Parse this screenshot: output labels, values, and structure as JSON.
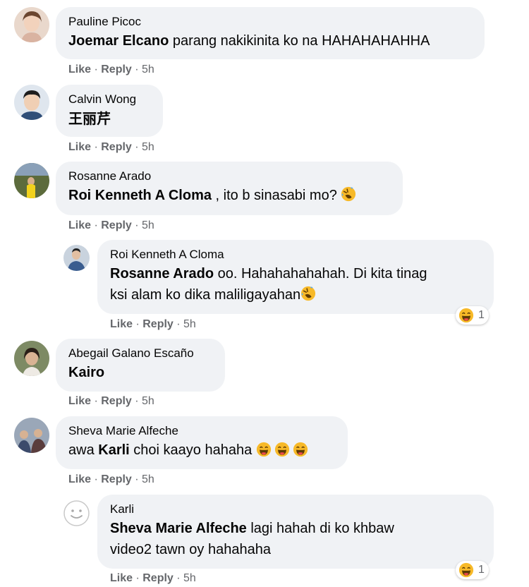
{
  "comments": [
    {
      "author": "Pauline Picoc",
      "mention": "Joemar Elcano",
      "text": " parang nakikinita ko na HAHAHAHAHHA",
      "like": "Like",
      "reply": "Reply",
      "time": "5h"
    },
    {
      "author": "Calvin Wong",
      "mention": "",
      "text": "王丽芹",
      "like": "Like",
      "reply": "Reply",
      "time": "5h"
    },
    {
      "author": "Rosanne Arado",
      "mention": "Roi Kenneth A Cloma",
      "text": " , ito b sinasabi mo?",
      "like": "Like",
      "reply": "Reply",
      "time": "5h"
    },
    {
      "author": "Roi Kenneth A Cloma",
      "mention": "Rosanne Arado",
      "line1": " oo. Hahahahahahah. Di kita tinag",
      "line2": "ksi alam ko dika maliligayahan",
      "like": "Like",
      "reply": "Reply",
      "time": "5h",
      "reaction_count": "1"
    },
    {
      "author": "Abegail Galano Escaño",
      "mention": "Kairo",
      "text": "",
      "like": "Like",
      "reply": "Reply",
      "time": "5h"
    },
    {
      "author": "Sheva Marie Alfeche",
      "prefix": "awa ",
      "mention": "Karli",
      "text": " choi kaayo hahaha",
      "like": "Like",
      "reply": "Reply",
      "time": "5h"
    },
    {
      "author": "Karli",
      "mention": "Sheva Marie Alfeche",
      "line1": " lagi hahah di ko khbaw",
      "line2": "video2 tawn oy hahahaha",
      "like": "Like",
      "reply": "Reply",
      "time": "5h",
      "reaction_count": "1"
    }
  ],
  "separator": " · ",
  "colors": {
    "bubble": "#f0f2f5",
    "meta": "#65676b",
    "text": "#050505",
    "emoji": "#f7b928"
  }
}
